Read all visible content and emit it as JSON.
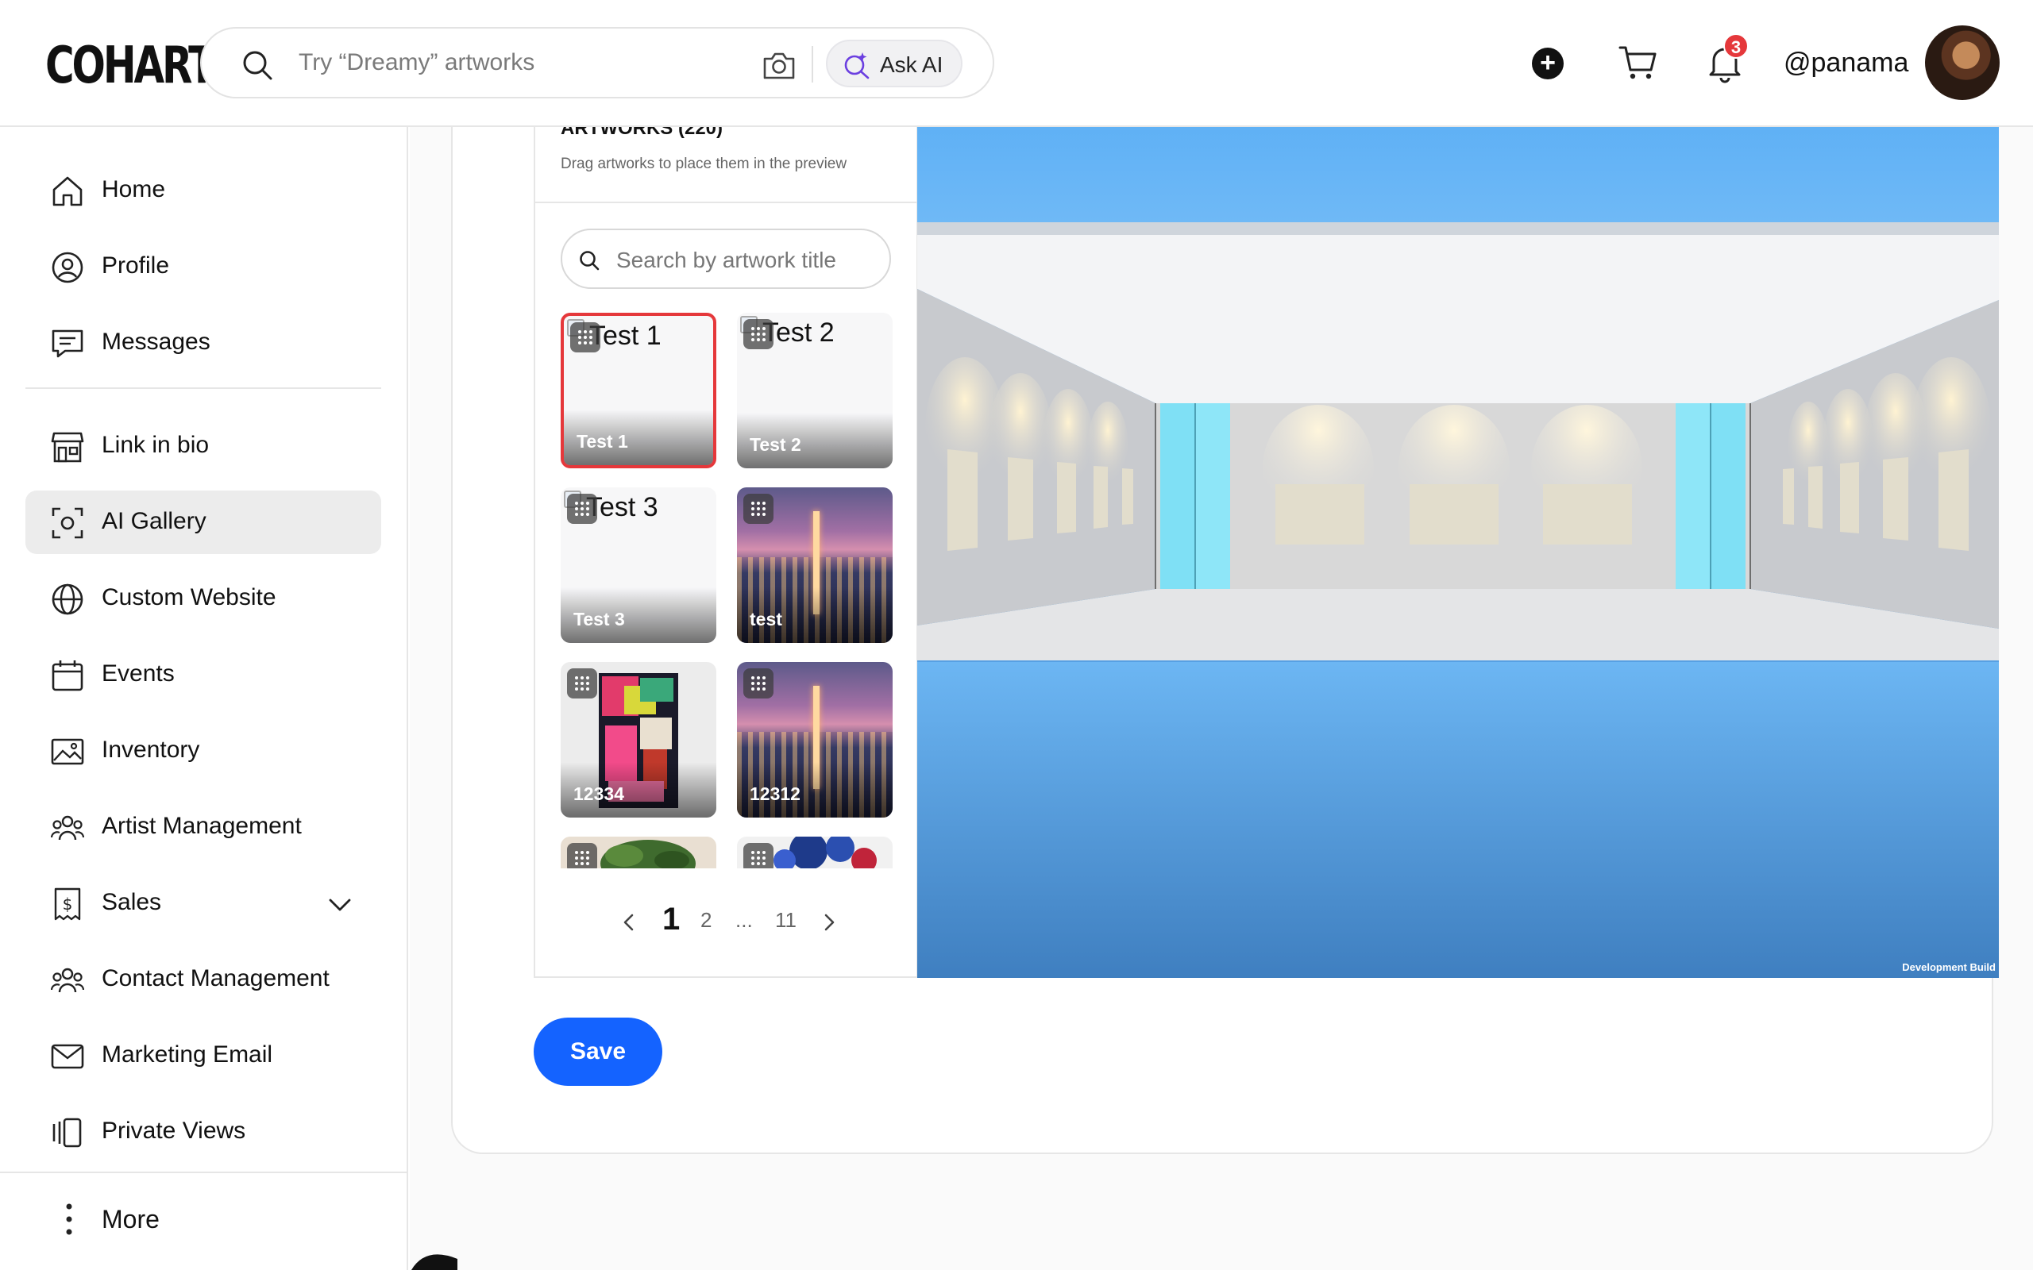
{
  "header": {
    "logo": "COHART",
    "search_placeholder": "Try “Dreamy” artworks",
    "ask_ai_label": "Ask AI",
    "notification_count": "3",
    "username": "@panama"
  },
  "sidebar": {
    "items": [
      {
        "label": "Home",
        "icon": "home-icon"
      },
      {
        "label": "Profile",
        "icon": "user-circle-icon"
      },
      {
        "label": "Messages",
        "icon": "chat-icon"
      },
      {
        "label": "Link in bio",
        "icon": "storefront-icon"
      },
      {
        "label": "AI Gallery",
        "icon": "scan-icon",
        "active": true
      },
      {
        "label": "Custom Website",
        "icon": "globe-icon"
      },
      {
        "label": "Events",
        "icon": "calendar-icon"
      },
      {
        "label": "Inventory",
        "icon": "image-icon"
      },
      {
        "label": "Artist Management",
        "icon": "group-icon"
      },
      {
        "label": "Sales",
        "icon": "dollar-receipt-icon",
        "expandable": true
      },
      {
        "label": "Contact Management",
        "icon": "group-icon"
      },
      {
        "label": "Marketing Email",
        "icon": "mail-icon"
      },
      {
        "label": "Private Views",
        "icon": "cards-icon"
      }
    ],
    "more_label": "More"
  },
  "artworks_panel": {
    "title": "ARTWORKS (220)",
    "subtitle": "Drag artworks to place them in the preview",
    "search_placeholder": "Search by artwork title",
    "tiles": [
      {
        "caption": "Test 1",
        "alt_text": "Test 1",
        "image": "broken",
        "selected": true
      },
      {
        "caption": "Test 2",
        "alt_text": "Test 2",
        "image": "broken"
      },
      {
        "caption": "Test 3",
        "alt_text": "Test 3",
        "image": "broken"
      },
      {
        "caption": "test",
        "image": "city-skyline"
      },
      {
        "caption": "12334",
        "image": "abstract-painting"
      },
      {
        "caption": "12312",
        "image": "city-skyline"
      },
      {
        "caption": "",
        "image": "plant"
      },
      {
        "caption": "",
        "image": "blue-flowers"
      }
    ],
    "pagination": {
      "current": "1",
      "pages": [
        "1",
        "2",
        "...",
        "11"
      ]
    }
  },
  "preview": {
    "watermark": "Development Build"
  },
  "actions": {
    "save_label": "Save"
  },
  "colors": {
    "accent": "#1463ff",
    "badge": "#e5383b",
    "selected_border": "#e5383b",
    "sky": "#66b4f7"
  }
}
